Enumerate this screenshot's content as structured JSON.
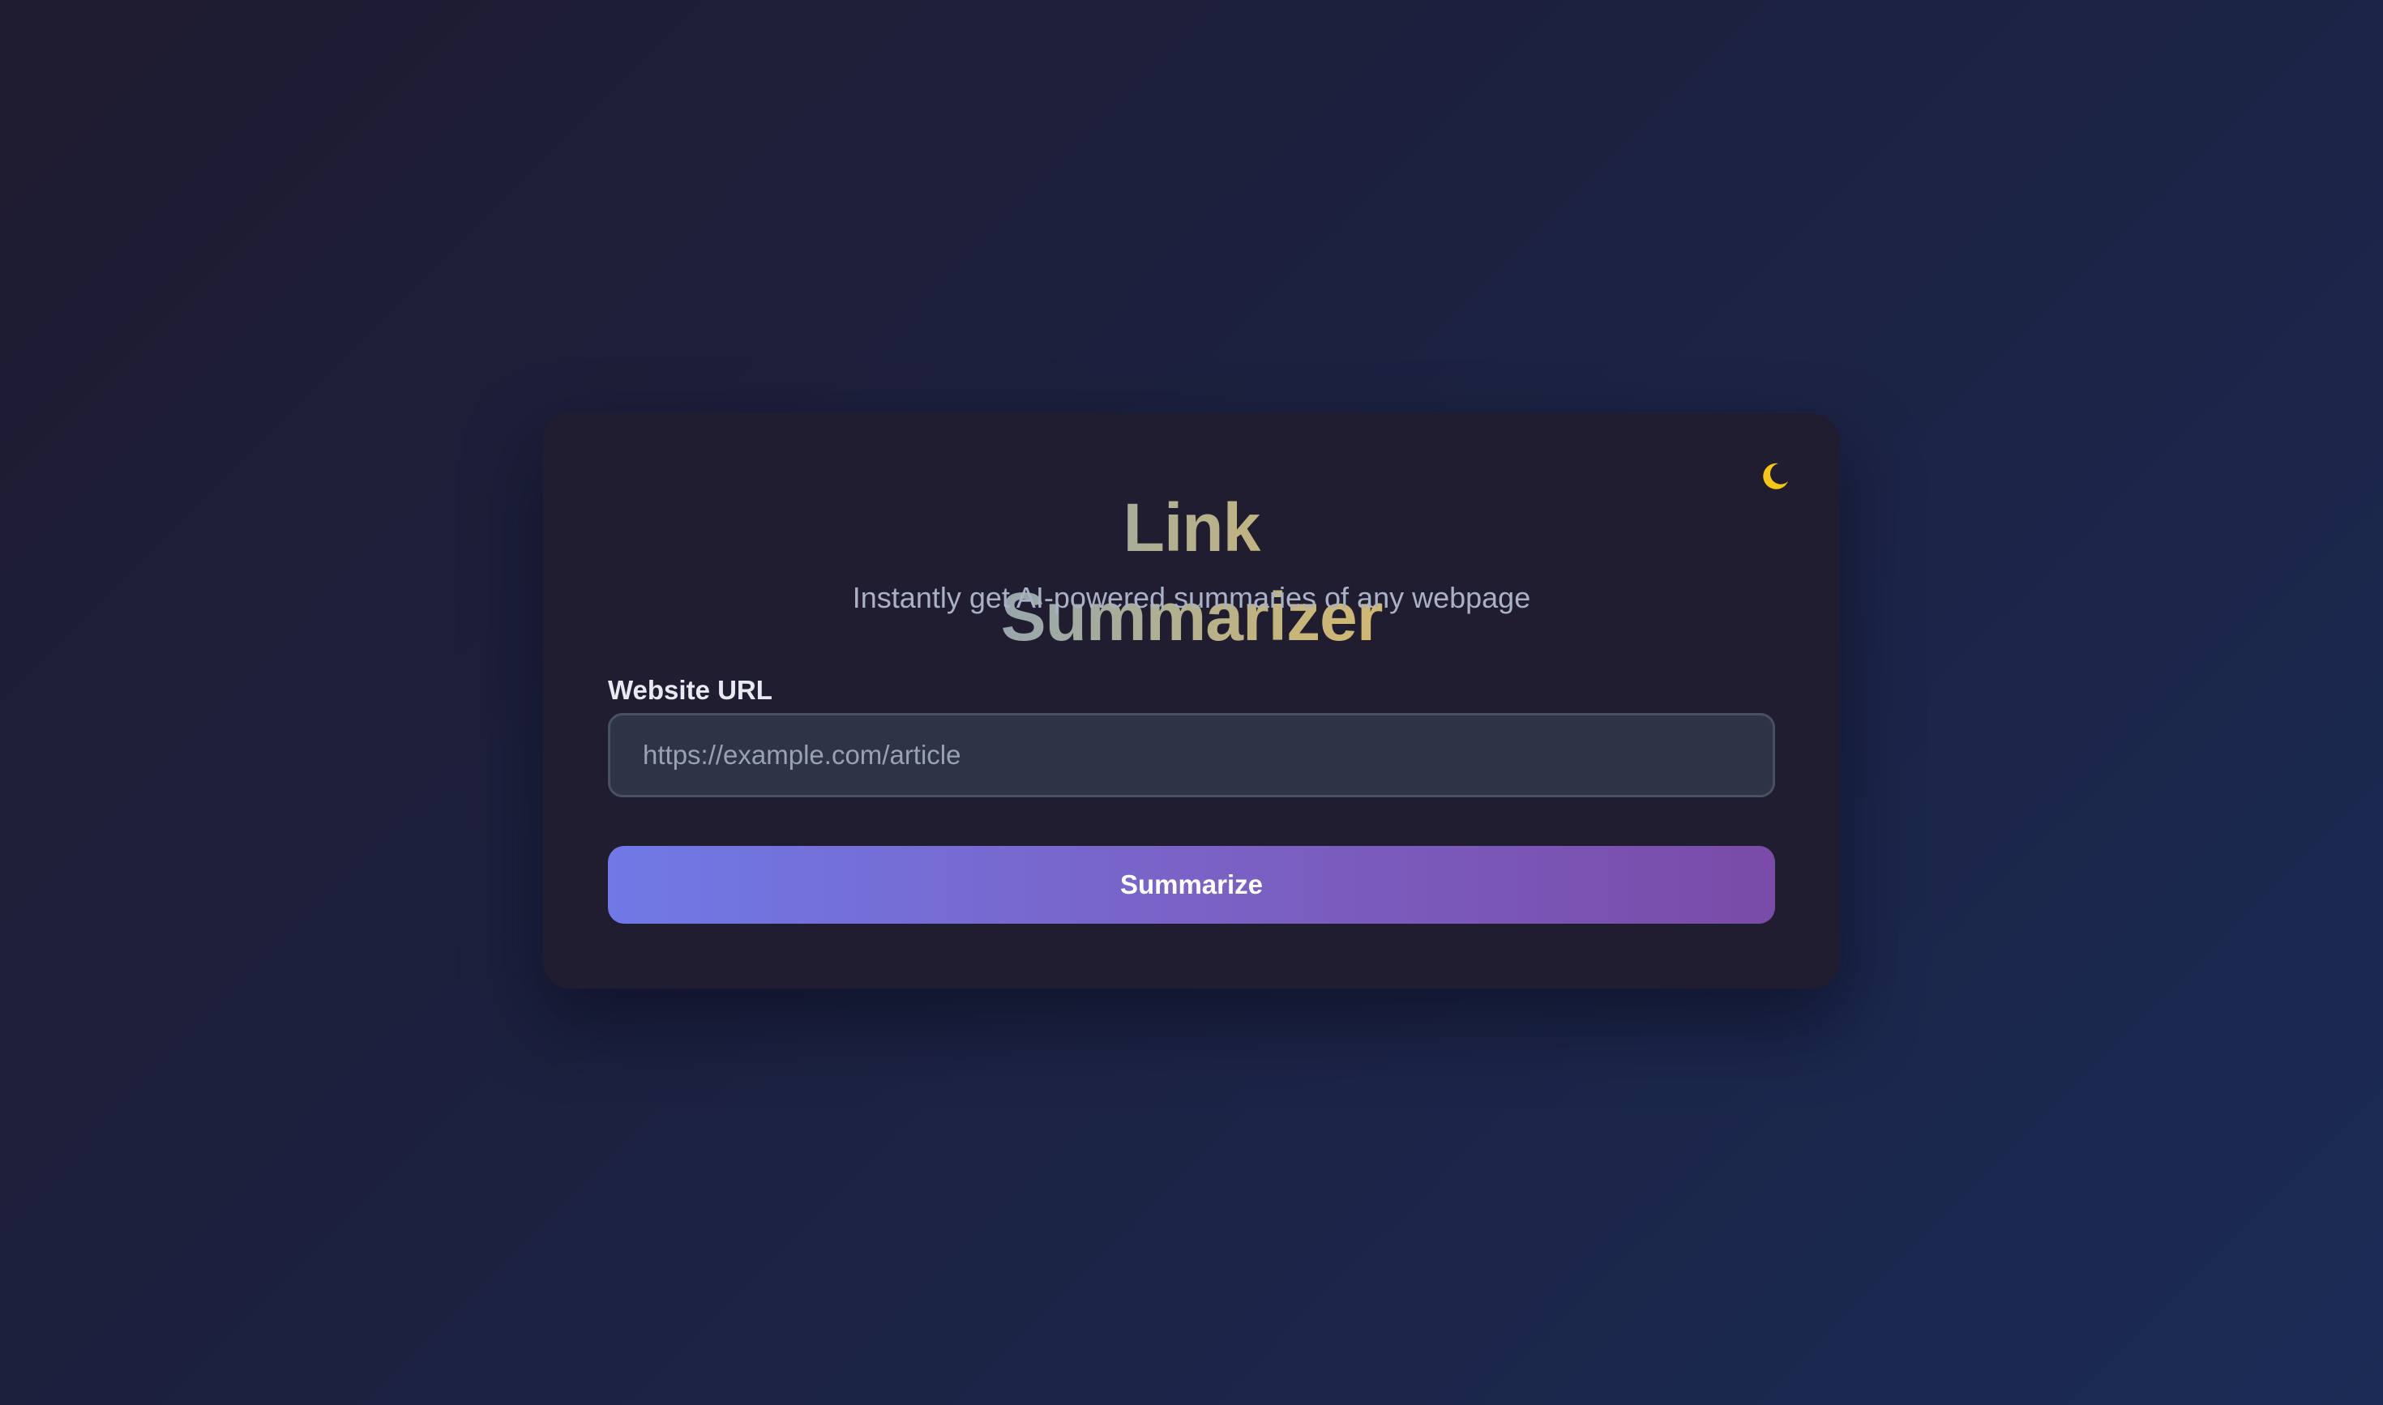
{
  "app": {
    "title": "Link Summarizer",
    "subtitle": "Instantly get AI-powered summaries of any webpage"
  },
  "theme_toggle": {
    "icon": "moon-icon",
    "color": "#f5c518"
  },
  "form": {
    "url_label": "Website URL",
    "url_placeholder": "https://example.com/article",
    "url_value": "",
    "submit_label": "Summarize"
  },
  "colors": {
    "button_gradient_start": "#7079e6",
    "button_gradient_end": "#7a4ba8",
    "title_gradient_start": "#8fa3b9",
    "title_gradient_end": "#d9bb6a"
  }
}
